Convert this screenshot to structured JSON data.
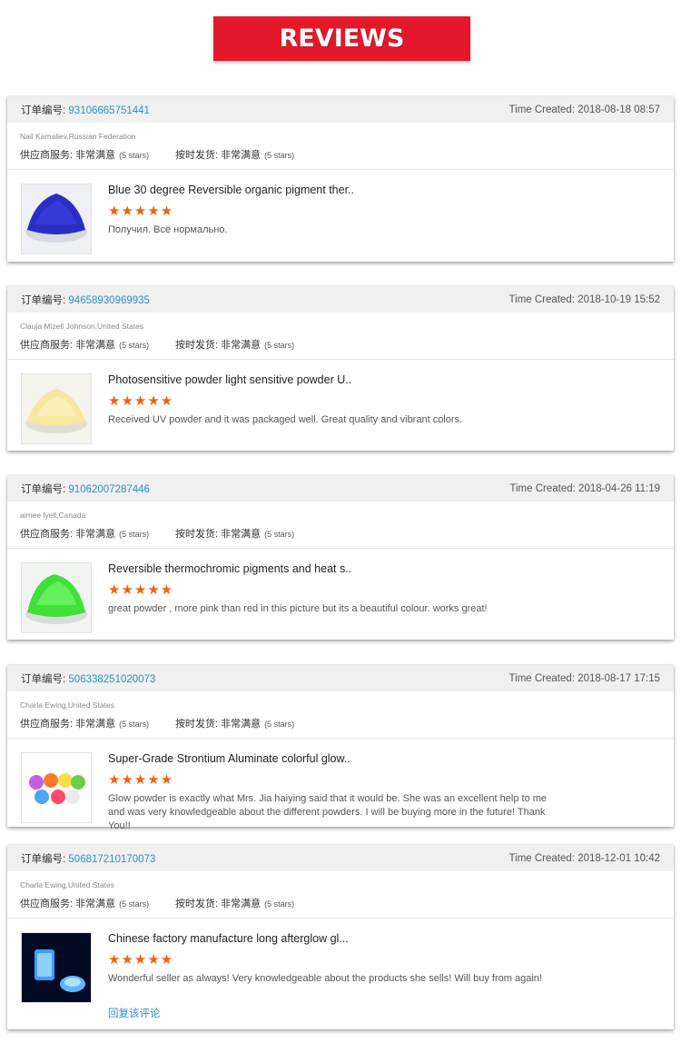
{
  "banner": {
    "title": "REVIEWS"
  },
  "labels": {
    "order_label": "订单编号:",
    "time_label": "Time Created:",
    "service_label": "供应商服务:",
    "shipping_label": "按时发货:"
  },
  "colors": {
    "accent": "#e3192b",
    "link": "#2b8fd0",
    "star": "#f0620d"
  },
  "reviews": [
    {
      "order_no": "93106665751441",
      "time": "2018-08-18 08:57",
      "buyer": "Nail Kamaliev,Russian Federation",
      "service_rating": "非常满意",
      "service_stars": "(5 stars)",
      "shipping_rating": "非常满意",
      "shipping_stars": "(5 stars)",
      "product": "Blue 30 degree Reversible organic pigment ther..",
      "stars": "★★★★★",
      "rating": 5,
      "comment": "Получил. Всё нормально.",
      "thumb_icon": "blue-pigment-image"
    },
    {
      "order_no": "94658930969935",
      "time": "2018-10-19 15:52",
      "buyer": "Clauja Mizell Johnson,United States",
      "service_rating": "非常满意",
      "service_stars": "(5 stars)",
      "shipping_rating": "非常满意",
      "shipping_stars": "(5 stars)",
      "product": "Photosensitive powder light sensitive powder U..",
      "stars": "★★★★★",
      "rating": 5,
      "comment": "Received UV powder and it was packaged well. Great quality and vibrant colors.",
      "thumb_icon": "yellow-powder-image"
    },
    {
      "order_no": "91062007287446",
      "time": "2018-04-26 11:19",
      "buyer": "aimee lyell,Canada",
      "service_rating": "非常满意",
      "service_stars": "(5 stars)",
      "shipping_rating": "非常满意",
      "shipping_stars": "(5 stars)",
      "product": "Reversible thermochromic pigments and heat s..",
      "stars": "★★★★★",
      "rating": 5,
      "comment": "great powder , more pink than red in this picture but its a beautiful colour. works great!",
      "thumb_icon": "green-pigment-image"
    },
    {
      "order_no": "506338251020073",
      "time": "2018-08-17 17:15",
      "buyer": "Charla Ewing,United States",
      "service_rating": "非常满意",
      "service_stars": "(5 stars)",
      "shipping_rating": "非常满意",
      "shipping_stars": "(5 stars)",
      "product": "Super-Grade Strontium Aluminate colorful glow..",
      "stars": "★★★★★",
      "rating": 5,
      "comment": "Glow powder is exactly what Mrs. Jia haiying said that it would be.  She was an excellent help to me and was very knowledgeable about the different powders.  I will be buying more in the future!  Thank You!!",
      "thumb_icon": "colorful-glow-powders-image"
    },
    {
      "order_no": "506817210170073",
      "time": "2018-12-01 10:42",
      "buyer": "Charla Ewing,United States",
      "service_rating": "非常满意",
      "service_stars": "(5 stars)",
      "shipping_rating": "非常满意",
      "shipping_stars": "(5 stars)",
      "product": "Chinese factory manufacture long afterglow gl...",
      "stars": "★★★★★",
      "rating": 5,
      "comment": "Wonderful seller as always!  Very knowledgeable about the products she sells!  Will buy from again!",
      "thumb_icon": "blue-glow-image",
      "reply": "回复该评论"
    }
  ]
}
